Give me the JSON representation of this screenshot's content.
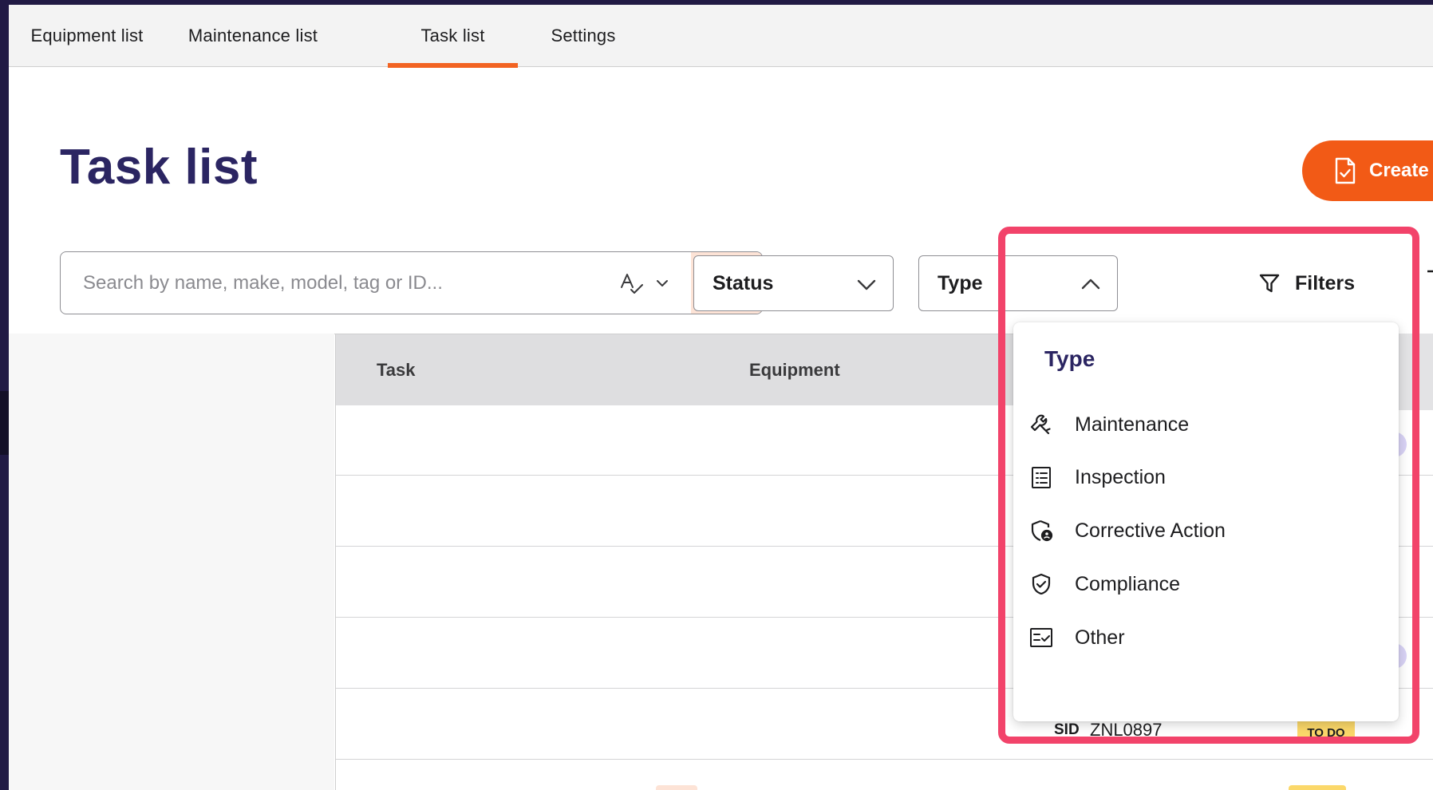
{
  "tabs": [
    {
      "label": "Equipment list",
      "active": false
    },
    {
      "label": "Maintenance list",
      "active": false
    },
    {
      "label": "Task list",
      "active": true
    },
    {
      "label": "Settings",
      "active": false
    }
  ],
  "page": {
    "title": "Task list"
  },
  "create_button": {
    "label": "Create",
    "icon": "document-check-icon",
    "color": "#f25a16"
  },
  "search": {
    "placeholder": "Search by name, make, model, tag or ID..."
  },
  "status_dropdown": {
    "label": "Status",
    "expanded": false
  },
  "type_dropdown": {
    "label": "Type",
    "expanded": true
  },
  "filters_button": {
    "label": "Filters",
    "icon": "filter-icon"
  },
  "table": {
    "columns": [
      "Task",
      "Equipment"
    ]
  },
  "type_menu": {
    "header": "Type",
    "items": [
      {
        "label": "Maintenance",
        "icon": "wrench-icon"
      },
      {
        "label": "Inspection",
        "icon": "checklist-icon"
      },
      {
        "label": "Corrective Action",
        "icon": "shield-person-icon"
      },
      {
        "label": "Compliance",
        "icon": "shield-check-icon"
      },
      {
        "label": "Other",
        "icon": "list-check-icon"
      }
    ]
  },
  "visible_row": {
    "sid_label": "SID",
    "sid_value": "ZNL0897",
    "status_badge": "TO DO"
  },
  "colors": {
    "accent": "#f26322",
    "title": "#2b2562",
    "highlight": "#f2436a",
    "badge": "#fbd86a"
  }
}
